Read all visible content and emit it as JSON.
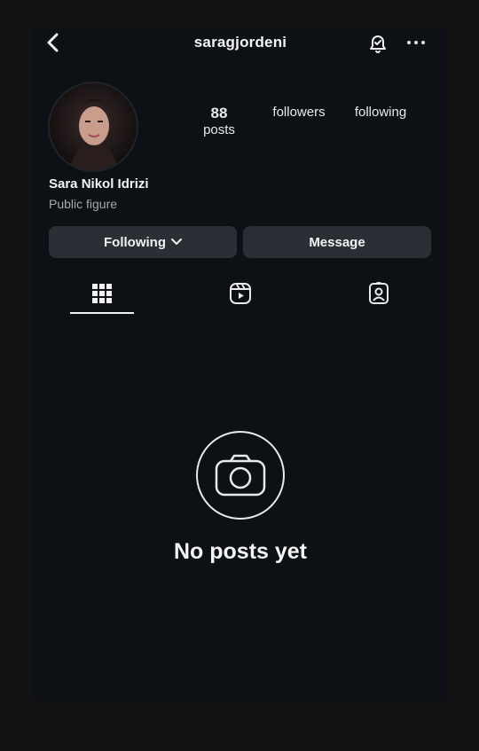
{
  "header": {
    "username": "saragjordeni",
    "back_icon": "chevron-left-icon",
    "notifications_icon": "bell-check-icon",
    "more_icon": "more-horizontal-icon"
  },
  "profile": {
    "posts_count": "88",
    "posts_label": "posts",
    "followers_label": "followers",
    "following_label": "following",
    "name": "Sara Nikol Idrizi",
    "category": "Public figure"
  },
  "actions": {
    "following_label": "Following",
    "message_label": "Message"
  },
  "tabs": [
    {
      "name": "grid-icon"
    },
    {
      "name": "reels-icon"
    },
    {
      "name": "tagged-icon"
    }
  ],
  "empty_state": {
    "title": "No posts yet",
    "icon": "camera-icon"
  },
  "colors": {
    "background": "#121212",
    "screen": "#0d1115",
    "button": "#2a2f35",
    "muted_text": "#a8a8a8"
  }
}
